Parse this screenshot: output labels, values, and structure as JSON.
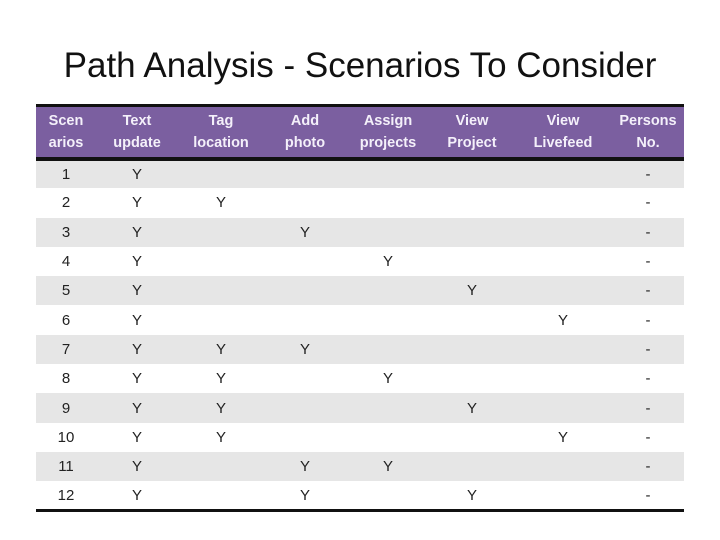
{
  "title": "Path Analysis - Scenarios To Consider",
  "colors": {
    "header_bg": "#7b5fa0",
    "header_text": "#f4f0fa",
    "row_shade": "#e6e6e6",
    "rule": "#111111"
  },
  "table": {
    "headers": [
      "Scen\narios",
      "Text\nupdate",
      "Tag\nlocation",
      "Add\nphoto",
      "Assign\nprojects",
      "View\nProject",
      "View\nLivefeed",
      "Persons\nNo."
    ],
    "rows": [
      [
        "1",
        "Y",
        "",
        "",
        "",
        "",
        "",
        "-"
      ],
      [
        "2",
        "Y",
        "Y",
        "",
        "",
        "",
        "",
        "-"
      ],
      [
        "3",
        "Y",
        "",
        "Y",
        "",
        "",
        "",
        "-"
      ],
      [
        "4",
        "Y",
        "",
        "",
        "Y",
        "",
        "",
        "-"
      ],
      [
        "5",
        "Y",
        "",
        "",
        "",
        "Y",
        "",
        "-"
      ],
      [
        "6",
        "Y",
        "",
        "",
        "",
        "",
        "Y",
        "-"
      ],
      [
        "7",
        "Y",
        "Y",
        "Y",
        "",
        "",
        "",
        "-"
      ],
      [
        "8",
        "Y",
        "Y",
        "",
        "Y",
        "",
        "",
        "-"
      ],
      [
        "9",
        "Y",
        "Y",
        "",
        "",
        "Y",
        "",
        "-"
      ],
      [
        "10",
        "Y",
        "Y",
        "",
        "",
        "",
        "Y",
        "-"
      ],
      [
        "11",
        "Y",
        "",
        "Y",
        "Y",
        "",
        "",
        "-"
      ],
      [
        "12",
        "Y",
        "",
        "Y",
        "",
        "Y",
        "",
        "-"
      ]
    ]
  }
}
